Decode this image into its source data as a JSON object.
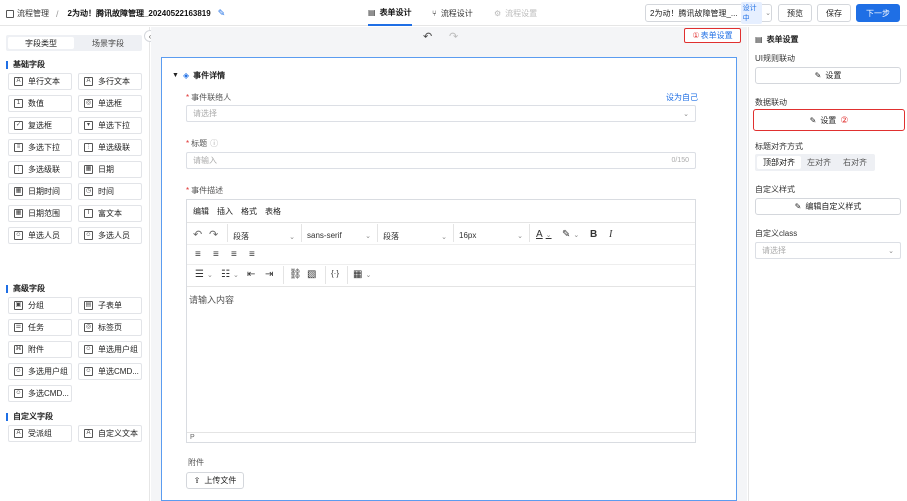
{
  "topbar": {
    "breadcrumb_root": "流程管理",
    "process_title": "2为动！腾讯故障管理_20240522163819",
    "tabs": [
      {
        "label": "表单设计",
        "active": true
      },
      {
        "label": "流程设计",
        "active": false
      },
      {
        "label": "流程设置",
        "active": false
      }
    ],
    "version_select": "2为动！腾讯故障管理_...",
    "version_badge": "设计中",
    "preview_label": "预览",
    "save_label": "保存",
    "next_label": "下一步"
  },
  "left": {
    "tabs": [
      {
        "label": "字段类型",
        "active": true
      },
      {
        "label": "场景字段",
        "active": false
      }
    ],
    "groups": [
      {
        "title": "基础字段",
        "items": [
          {
            "label": "单行文本",
            "icon": "text-icon",
            "glyph": "A"
          },
          {
            "label": "多行文本",
            "icon": "multiline-text-icon",
            "glyph": "A"
          },
          {
            "label": "数值",
            "icon": "number-icon",
            "glyph": "1"
          },
          {
            "label": "单选框",
            "icon": "radio-icon",
            "glyph": "◎"
          },
          {
            "label": "复选框",
            "icon": "checkbox-icon",
            "glyph": "✓"
          },
          {
            "label": "单选下拉",
            "icon": "dropdown-icon",
            "glyph": "▾"
          },
          {
            "label": "多选下拉",
            "icon": "multi-dropdown-icon",
            "glyph": "≡"
          },
          {
            "label": "单选级联",
            "icon": "cascade-icon",
            "glyph": "⋮"
          },
          {
            "label": "多选级联",
            "icon": "multi-cascade-icon",
            "glyph": "⋮"
          },
          {
            "label": "日期",
            "icon": "calendar-icon",
            "glyph": "▦"
          },
          {
            "label": "日期时间",
            "icon": "datetime-icon",
            "glyph": "▦"
          },
          {
            "label": "时间",
            "icon": "clock-icon",
            "glyph": "◷"
          },
          {
            "label": "日期范围",
            "icon": "date-range-icon",
            "glyph": "▦"
          },
          {
            "label": "富文本",
            "icon": "rich-text-icon",
            "glyph": "T"
          },
          {
            "label": "单选人员",
            "icon": "user-icon",
            "glyph": "☺"
          },
          {
            "label": "多选人员",
            "icon": "users-icon",
            "glyph": "☺"
          }
        ]
      },
      {
        "title": "高级字段",
        "items": [
          {
            "label": "分组",
            "icon": "group-icon",
            "glyph": "▣"
          },
          {
            "label": "子表单",
            "icon": "subform-icon",
            "glyph": "▤"
          },
          {
            "label": "任务",
            "icon": "task-icon",
            "glyph": "☰"
          },
          {
            "label": "标签页",
            "icon": "tabs-icon",
            "glyph": "◎"
          },
          {
            "label": "附件",
            "icon": "attachment-icon",
            "glyph": "⌘"
          },
          {
            "label": "单选用户组",
            "icon": "usergroup-icon",
            "glyph": "☺"
          },
          {
            "label": "多选用户组",
            "icon": "multi-usergroup-icon",
            "glyph": "☺"
          },
          {
            "label": "单选CMD...",
            "icon": "cmdb-icon",
            "glyph": "☺"
          },
          {
            "label": "多选CMD...",
            "icon": "multi-cmdb-icon",
            "glyph": "☺"
          }
        ]
      },
      {
        "title": "自定义字段",
        "items": [
          {
            "label": "受派组",
            "icon": "assign-group-icon",
            "glyph": "A"
          },
          {
            "label": "自定义文本",
            "icon": "custom-text-icon",
            "glyph": "A"
          }
        ]
      }
    ]
  },
  "canvas": {
    "form_settings_label": "表单设置",
    "form_settings_marker": "①",
    "section_title": "事件详情",
    "contact_label": "事件联络人",
    "set_self_link": "设为自己",
    "contact_placeholder": "请选择",
    "title_label": "标题",
    "title_placeholder": "请输入",
    "title_counter": "0/150",
    "desc_label": "事件描述",
    "editor_menus": [
      "编辑",
      "插入",
      "格式",
      "表格"
    ],
    "block_select1": "段落",
    "font_select": "sans-serif",
    "block_select2": "段落",
    "size_select": "16px",
    "editor_placeholder": "请输入内容",
    "editor_status": "P",
    "attachment_label": "附件",
    "upload_label": "上传文件"
  },
  "right": {
    "title": "表单设置",
    "ui_rule_label": "UI规则联动",
    "ui_rule_btn": "设置",
    "data_link_label": "数据联动",
    "data_link_btn": "设置",
    "data_link_marker": "②",
    "align_label": "标题对齐方式",
    "align_options": [
      {
        "label": "顶部对齐",
        "active": true
      },
      {
        "label": "左对齐",
        "active": false
      },
      {
        "label": "右对齐",
        "active": false
      }
    ],
    "style_label": "自定义样式",
    "style_btn": "编辑自定义样式",
    "class_label": "自定义class",
    "class_placeholder": "请选择"
  },
  "colors": {
    "primary": "#1f6fe5",
    "highlight": "#e0302f",
    "required": "#e0302f"
  }
}
